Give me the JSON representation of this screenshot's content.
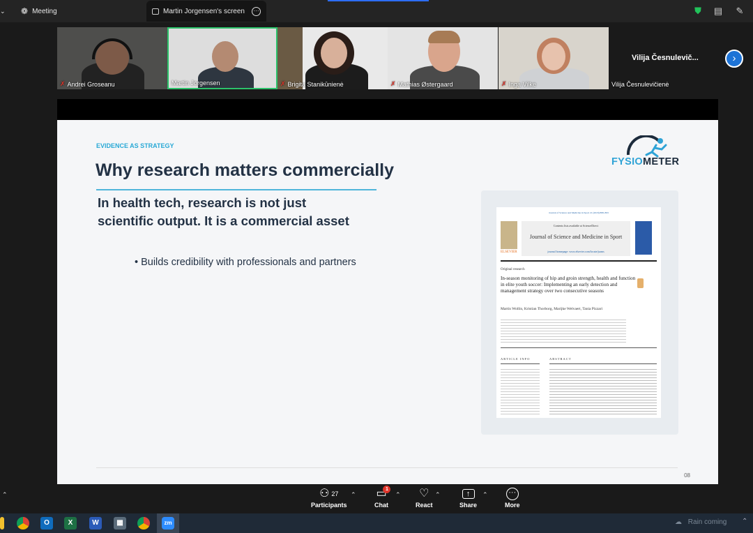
{
  "topbar": {
    "meeting_label": "Meeting",
    "screen_tab": "Martin Jorgensen's screen"
  },
  "participants": [
    {
      "name": "Andrei Groseanu",
      "muted": true
    },
    {
      "name": "Martin Jorgensen",
      "muted": false
    },
    {
      "name": "Brigita Stanikūnienė",
      "muted": true
    },
    {
      "name": "Mathias Østergaard",
      "muted": true
    },
    {
      "name": "Inga Vilke",
      "muted": true
    },
    {
      "name": "Vilija Česnulevičienė",
      "muted": false,
      "tile_label": "Vilija Česnulevič..."
    }
  ],
  "slide": {
    "kicker": "EVIDENCE AS STRATEGY",
    "title": "Why research matters commercially",
    "lead": "In health tech, research is not just scientific output. It is a commercial asset",
    "bullet": "• Builds credibility with professionals and partners",
    "logo_a": "FYSIO",
    "logo_b": "METER",
    "page_number": "08",
    "paper": {
      "journal_line": "Journal of Science and Medicine in Sport 21 (2018) 888–893",
      "contents": "Contents lists available at ScienceDirect",
      "journal": "Journal of Science and Medicine in Sport",
      "homepage": "journal homepage: www.elsevier.com/locate/jsams",
      "publisher": "ELSEVIER",
      "section": "Original research",
      "title": "In-season monitoring of hip and groin strength, health and function in elite youth soccer: Implementing an early detection and management strategy over two consecutive seasons",
      "authors": "Martin Wollin, Kristian Thorborg, Marijke Welvaert, Tania Pizzari",
      "article_info": "ARTICLE INFO",
      "abstract": "ABSTRACT"
    }
  },
  "controls": {
    "participants_label": "Participants",
    "participants_count": "27",
    "chat_label": "Chat",
    "chat_badge": "1",
    "react_label": "React",
    "share_label": "Share",
    "more_label": "More"
  },
  "taskbar": {
    "weather": "Rain coming",
    "zoom_label": "zm"
  },
  "colors": {
    "accent_blue": "#1d73d6",
    "share_green": "#21a453",
    "slide_title": "#233245",
    "kicker": "#29a9d6"
  }
}
